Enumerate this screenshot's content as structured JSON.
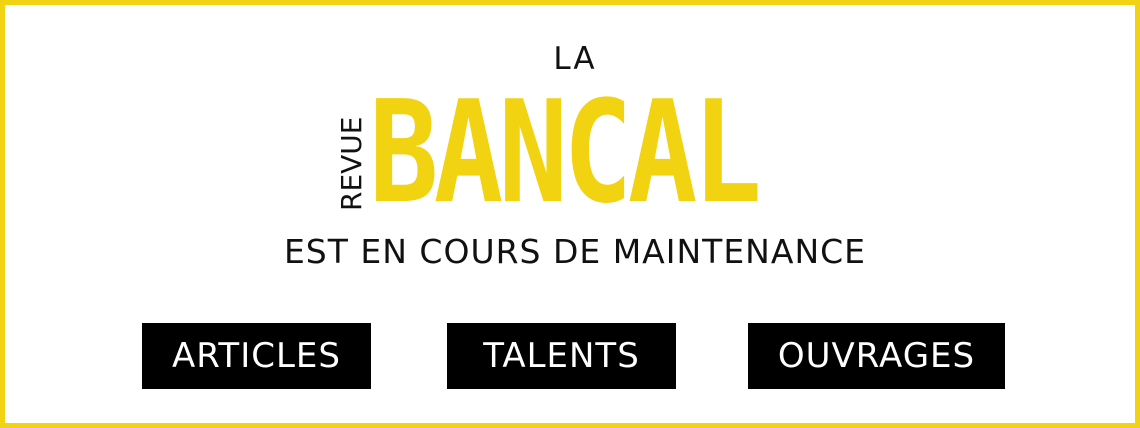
{
  "header": {
    "prefix": "LA",
    "logo_small": "REVUE",
    "logo_main": "BANCAL",
    "status": "EST EN COURS DE MAINTENANCE"
  },
  "nav": {
    "items": [
      {
        "label": "ARTICLES"
      },
      {
        "label": "TALENTS"
      },
      {
        "label": "OUVRAGES"
      }
    ]
  },
  "colors": {
    "brand_yellow": "#f2d312",
    "text": "#111111",
    "button_bg": "#000000",
    "button_text": "#ffffff"
  }
}
